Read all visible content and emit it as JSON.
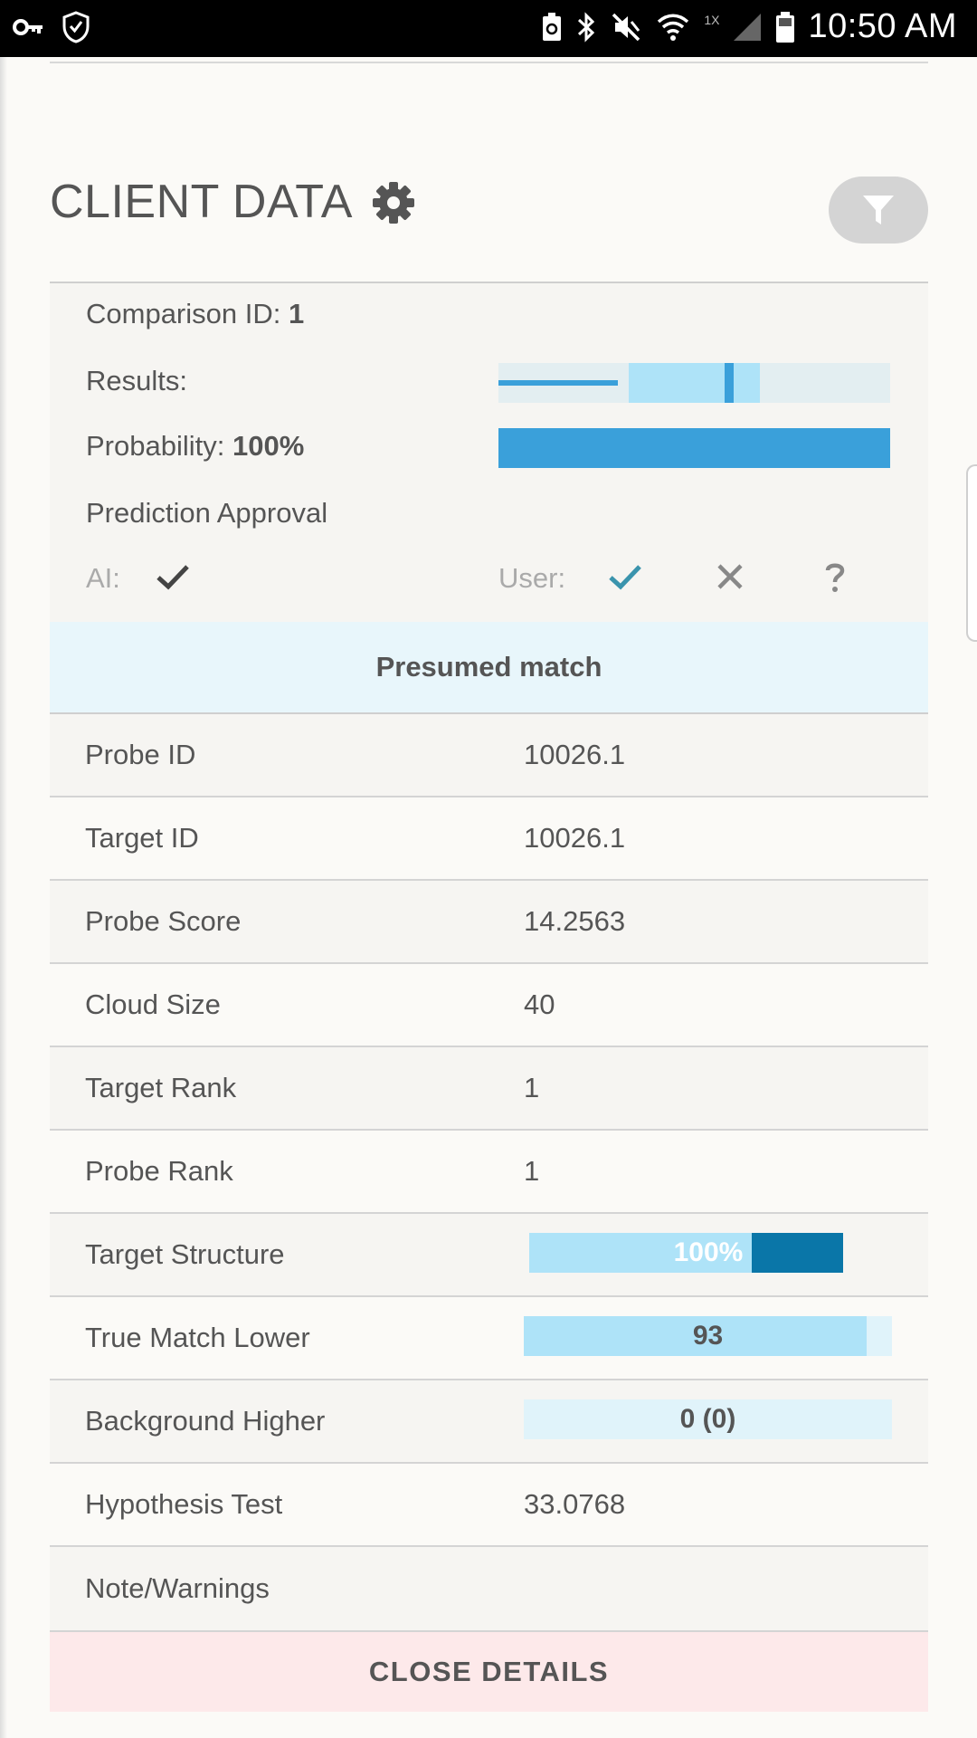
{
  "status_bar": {
    "time": "10:50 AM",
    "network_label": "1X",
    "icons": [
      "key-icon",
      "shield-icon",
      "battery-saver-icon",
      "bluetooth-icon",
      "mute-icon",
      "wifi-icon",
      "signal-icon",
      "battery-icon"
    ]
  },
  "header": {
    "title": "CLIENT DATA",
    "settings_icon": "gear-icon",
    "filter_icon": "filter-icon"
  },
  "summary": {
    "comparison_label": "Comparison ID:",
    "comparison_value": "1",
    "results_label": "Results:",
    "results_bar": {
      "band_start": 0.333,
      "band_end": 0.667,
      "line_end": 0.305,
      "marker": 0.59
    },
    "probability_label": "Probability:",
    "probability_value": "100%",
    "probability_fraction": 1.0,
    "prediction_label": "Prediction Approval",
    "ai_label": "AI:",
    "ai_status": "check-icon",
    "user_label": "User:",
    "user_options": [
      "check-icon",
      "close-icon",
      "question-icon"
    ]
  },
  "status_banner": "Presumed match",
  "rows": [
    {
      "key": "Probe ID",
      "value": "10026.1"
    },
    {
      "key": "Target ID",
      "value": "10026.1"
    },
    {
      "key": "Probe Score",
      "value": "14.2563"
    },
    {
      "key": "Cloud Size",
      "value": "40"
    },
    {
      "key": "Target Rank",
      "value": "1"
    },
    {
      "key": "Probe Rank",
      "value": "1"
    }
  ],
  "target_structure": {
    "label": "Target Structure",
    "text": "100%",
    "fill_fraction": 0.71
  },
  "true_match_lower": {
    "label": "True Match Lower",
    "text": "93",
    "fill_fraction": 0.93
  },
  "background_higher": {
    "label": "Background Higher",
    "text": "0 (0)",
    "fill_fraction": 0.0
  },
  "hypothesis": {
    "label": "Hypothesis Test",
    "value": "33.0768"
  },
  "notes": {
    "label": "Note/Warnings",
    "value": ""
  },
  "close_button": "CLOSE DETAILS",
  "colors": {
    "accent": "#3aa0da",
    "light_bar": "#aee3f8",
    "dark_bar": "#0a76a8",
    "banner": "#e8f6fb",
    "close_bg": "#fde9ea"
  }
}
